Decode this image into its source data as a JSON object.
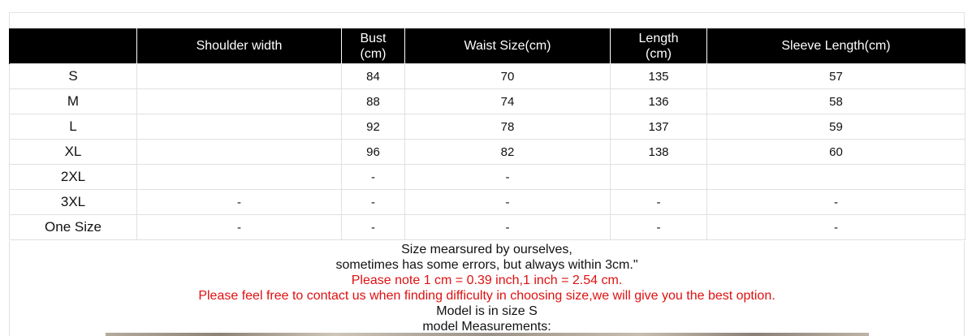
{
  "table": {
    "headers": [
      {
        "line1": "",
        "line2": ""
      },
      {
        "line1": "Shoulder width",
        "line2": ""
      },
      {
        "line1": "Bust",
        "line2": "(cm)"
      },
      {
        "line1": "Waist Size(cm)",
        "line2": ""
      },
      {
        "line1": "Length",
        "line2": "(cm)"
      },
      {
        "line1": "Sleeve Length(cm)",
        "line2": ""
      }
    ],
    "rows": [
      {
        "size": "S",
        "shoulder": "",
        "bust": "84",
        "waist": "70",
        "length": "135",
        "sleeve": "57"
      },
      {
        "size": "M",
        "shoulder": "",
        "bust": "88",
        "waist": "74",
        "length": "136",
        "sleeve": "58"
      },
      {
        "size": "L",
        "shoulder": "",
        "bust": "92",
        "waist": "78",
        "length": "137",
        "sleeve": "59"
      },
      {
        "size": "XL",
        "shoulder": "",
        "bust": "96",
        "waist": "82",
        "length": "138",
        "sleeve": "60"
      },
      {
        "size": "2XL",
        "shoulder": "",
        "bust": "-",
        "waist": "-",
        "length": "",
        "sleeve": ""
      },
      {
        "size": "3XL",
        "shoulder": "-",
        "bust": "-",
        "waist": "-",
        "length": "-",
        "sleeve": "-"
      },
      {
        "size": "One Size",
        "shoulder": "-",
        "bust": "-",
        "waist": "-",
        "length": "-",
        "sleeve": "-"
      }
    ]
  },
  "notes": {
    "line1": "Size mearsured by ourselves,",
    "line2": "sometimes has some errors, but always within 3cm.\"",
    "line3": "Please note 1 cm = 0.39 inch,1 inch = 2.54 cm.",
    "line4": "Please feel free to contact us when finding difficulty in choosing size,we will give you the best option.",
    "line5": "Model is in size S",
    "line6": "model Measurements:"
  },
  "colors": {
    "header_bg": "#000000",
    "header_text": "#ffffff",
    "note_highlight": "#e01010"
  }
}
